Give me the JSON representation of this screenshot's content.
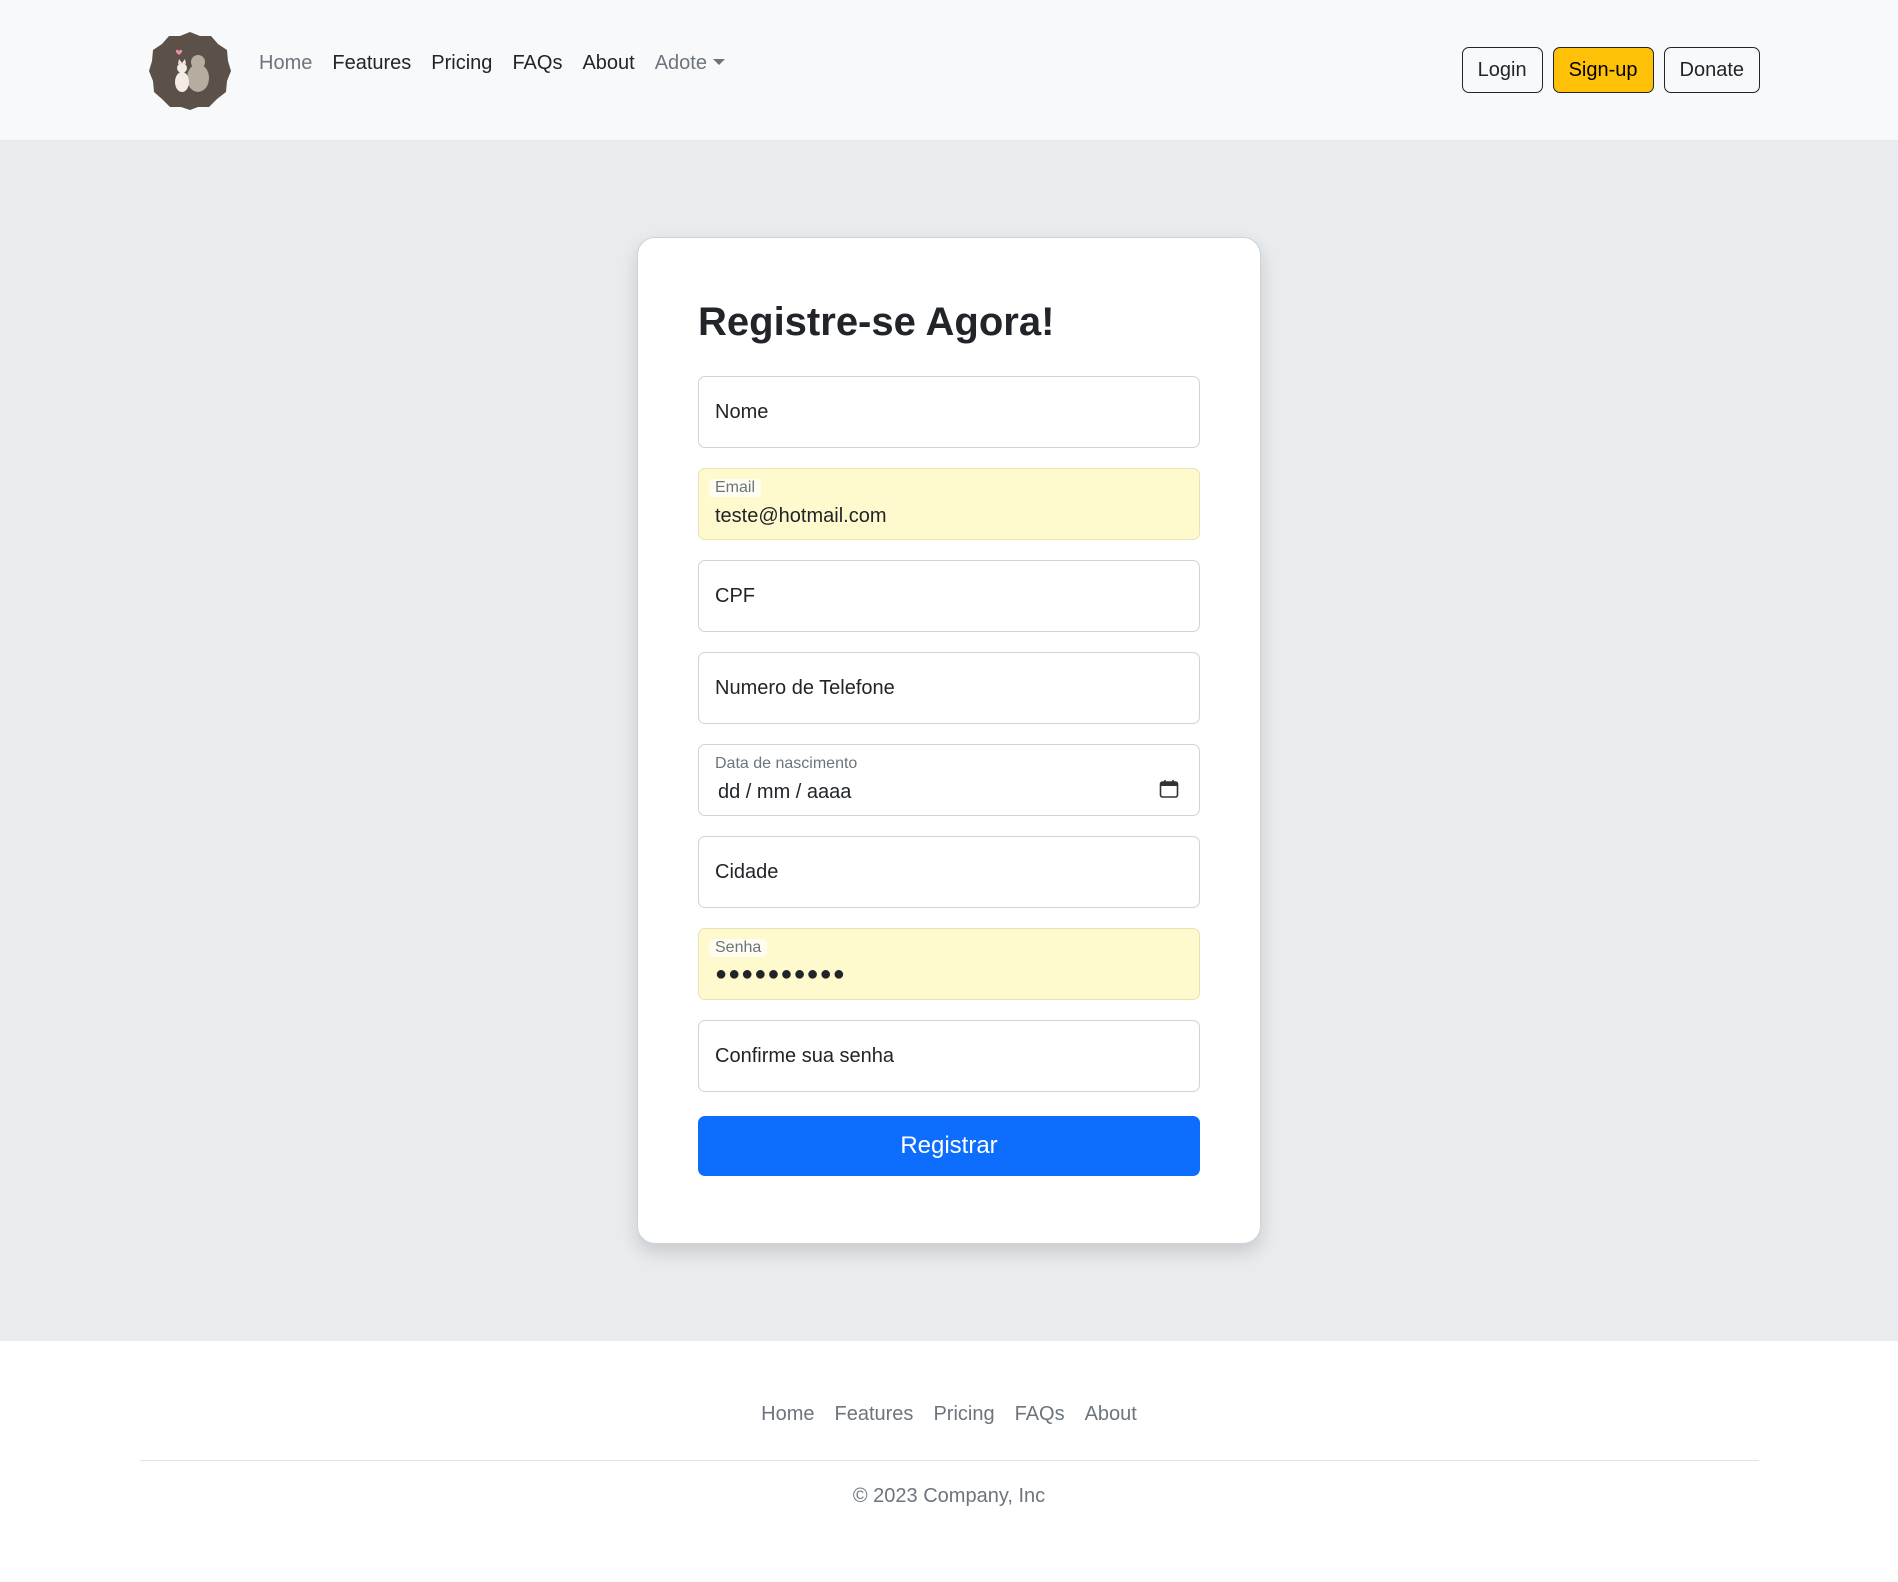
{
  "navbar": {
    "links": [
      "Home",
      "Features",
      "Pricing",
      "FAQs",
      "About",
      "Adote"
    ],
    "buttons": {
      "login": "Login",
      "signup": "Sign-up",
      "donate": "Donate"
    }
  },
  "form": {
    "title": "Registre-se Agora!",
    "fields": {
      "nome": {
        "placeholder": "Nome"
      },
      "email": {
        "label": "Email",
        "value": "teste@hotmail.com"
      },
      "cpf": {
        "placeholder": "CPF"
      },
      "telefone": {
        "placeholder": "Numero de Telefone"
      },
      "nascimento": {
        "label": "Data de nascimento",
        "value": "dd / mm / aaaa"
      },
      "cidade": {
        "placeholder": "Cidade"
      },
      "senha": {
        "label": "Senha",
        "value": "●●●●●●●●●●"
      },
      "confirme": {
        "placeholder": "Confirme sua senha"
      }
    },
    "submit": "Registrar"
  },
  "footer": {
    "links": [
      "Home",
      "Features",
      "Pricing",
      "FAQs",
      "About"
    ],
    "copyright": "© 2023 Company, Inc"
  },
  "colors": {
    "primary": "#0d6efd",
    "warning": "#ffc107",
    "autofill": "#fffacd",
    "logo": "#5b5148"
  },
  "icons": [
    "logo-cat-dog-icon",
    "calendar-icon",
    "chevron-down-icon"
  ]
}
